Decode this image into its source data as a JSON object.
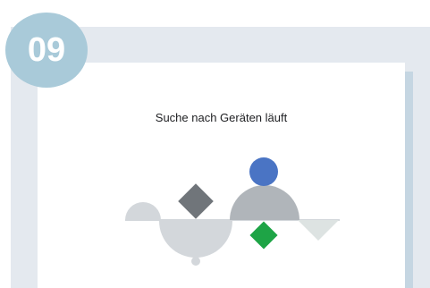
{
  "step_badge": {
    "number": "09"
  },
  "dialog": {
    "title": "Suche nach Geräten läuft"
  },
  "colors": {
    "badge": "#a9cad9",
    "background_panel": "#e4e9ef",
    "side_strip": "#c5d6e2",
    "shape_blue": "#4a74c4",
    "shape_gray_dark": "#70757a",
    "shape_gray_mid": "#b0b5ba",
    "shape_gray_light": "#d3d7db",
    "shape_green": "#1ea446"
  }
}
